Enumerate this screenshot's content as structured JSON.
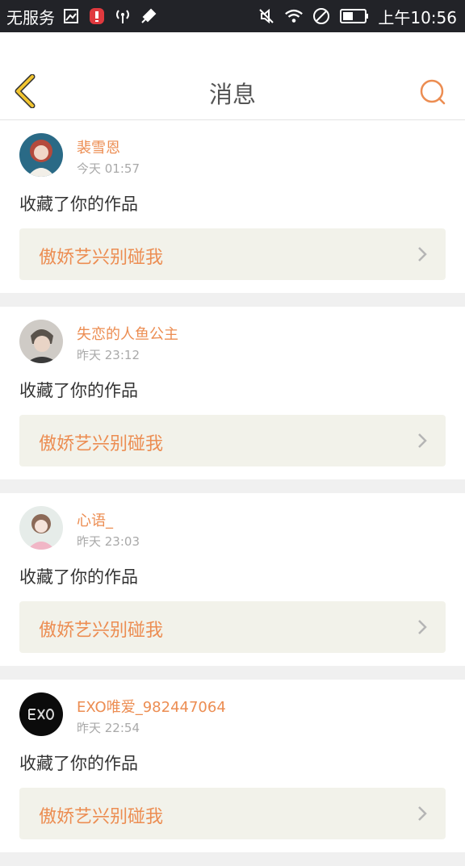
{
  "status_bar": {
    "carrier": "无服务",
    "time": "上午10:56"
  },
  "header": {
    "title": "消息"
  },
  "notifications": [
    {
      "username": "裴雪恩",
      "time": "今天 01:57",
      "action": "收藏了你的作品",
      "work_title": "傲娇艺兴别碰我"
    },
    {
      "username": "失恋的人鱼公主",
      "time": "昨天 23:12",
      "action": "收藏了你的作品",
      "work_title": "傲娇艺兴别碰我"
    },
    {
      "username": "心语_",
      "time": "昨天 23:03",
      "action": "收藏了你的作品",
      "work_title": "傲娇艺兴别碰我"
    },
    {
      "username": "EXO唯爱_982447064",
      "time": "昨天 22:54",
      "action": "收藏了你的作品",
      "work_title": "傲娇艺兴别碰我"
    }
  ],
  "colors": {
    "accent": "#ec8d52",
    "back_arrow": "#f2c530",
    "status_bar_bg": "#222328"
  },
  "icons": {
    "back": "back-arrow-icon",
    "search": "search-icon"
  }
}
